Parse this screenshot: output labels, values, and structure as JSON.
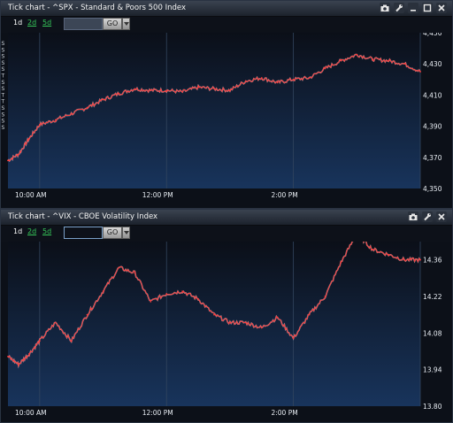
{
  "colors": {
    "line": "#ff3b3b",
    "line_shadow": "#ffffff",
    "plot_top": "#0b0f18",
    "plot_bottom": "#18345c",
    "grid": "#33465f"
  },
  "top_window": {
    "title": "Tick chart - ^SPX - Standard & Poors 500 Index",
    "ranges": [
      "1d",
      "2d",
      "5d"
    ],
    "symbol_value": "",
    "go_label": "GO",
    "icons": [
      "camera-icon",
      "wrench-icon",
      "minimize-icon",
      "maximize-icon",
      "close-icon"
    ],
    "left_edge_glyphs": [
      "S",
      "S",
      "S",
      "S",
      "S",
      "T",
      "S",
      "S",
      "T",
      "T",
      "S",
      "S",
      "S",
      "S"
    ]
  },
  "bottom_window": {
    "title": "Tick chart - ^VIX - CBOE Volatility Index",
    "ranges": [
      "1d",
      "2d",
      "5d"
    ],
    "symbol_value": "",
    "go_label": "GO",
    "icons": [
      "camera-icon",
      "wrench-icon",
      "close-icon"
    ]
  },
  "chart_data": [
    {
      "type": "line",
      "series": [
        {
          "values_x": [
            "09:30",
            "09:40",
            "09:50",
            "10:00",
            "10:15",
            "10:30",
            "10:45",
            "11:00",
            "11:15",
            "11:30",
            "11:45",
            "12:00",
            "12:15",
            "12:30",
            "12:45",
            "13:00",
            "13:15",
            "13:30",
            "13:45",
            "14:00",
            "14:15",
            "14:30",
            "14:45",
            "15:00",
            "15:15",
            "15:30",
            "15:45",
            "16:00"
          ],
          "values": [
            4368,
            4372,
            4382,
            4391,
            4394,
            4398,
            4402,
            4407,
            4411,
            4414,
            4413,
            4413,
            4412,
            4415,
            4414,
            4413,
            4419,
            4421,
            4418,
            4420,
            4421,
            4427,
            4432,
            4436,
            4433,
            4432,
            4430,
            4425
          ]
        }
      ],
      "xticks": [
        "10:00 AM",
        "12:00 PM",
        "2:00 PM"
      ],
      "yticks": [
        "4,450",
        "4,430",
        "4,410",
        "4,390",
        "4,370",
        "4,350"
      ],
      "ylim": [
        4350,
        4450
      ],
      "xlim": [
        "09:30",
        "16:00"
      ],
      "grid": true
    },
    {
      "type": "line",
      "series": [
        {
          "values_x": [
            "09:30",
            "09:40",
            "09:50",
            "10:00",
            "10:15",
            "10:30",
            "10:45",
            "11:00",
            "11:15",
            "11:30",
            "11:45",
            "12:00",
            "12:15",
            "12:30",
            "12:45",
            "13:00",
            "13:15",
            "13:30",
            "13:45",
            "14:00",
            "14:15",
            "14:30",
            "14:45",
            "15:00",
            "15:15",
            "15:30",
            "15:45",
            "16:00"
          ],
          "values": [
            13.99,
            13.96,
            14.0,
            14.05,
            14.12,
            14.05,
            14.15,
            14.24,
            14.33,
            14.31,
            14.2,
            14.23,
            14.24,
            14.21,
            14.15,
            14.12,
            14.12,
            14.1,
            14.14,
            14.06,
            14.15,
            14.22,
            14.35,
            14.46,
            14.4,
            14.38,
            14.36,
            14.36
          ]
        }
      ],
      "xticks": [
        "10:00 AM",
        "12:00 PM",
        "2:00 PM"
      ],
      "yticks": [
        "14.36",
        "14.22",
        "14.08",
        "13.94",
        "13.80"
      ],
      "ylim": [
        13.8,
        14.43
      ],
      "xlim": [
        "09:30",
        "16:00"
      ],
      "grid": true
    }
  ]
}
